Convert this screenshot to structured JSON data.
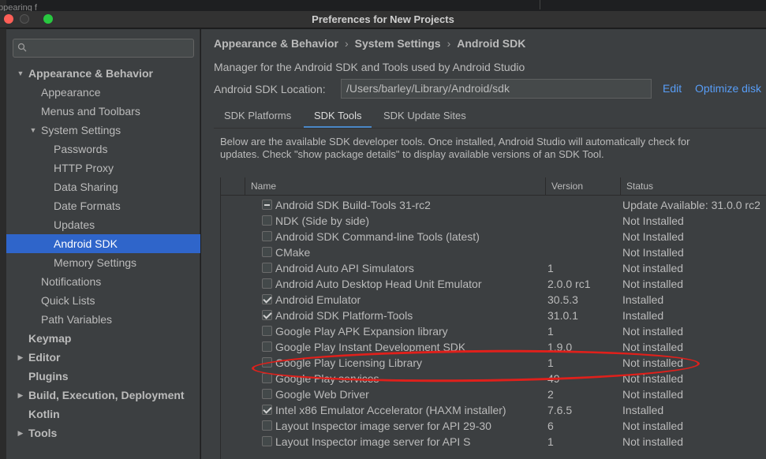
{
  "background_window": {
    "text": "ppearing f"
  },
  "window": {
    "title": "Preferences for New Projects"
  },
  "sidebar": {
    "search_placeholder": "Q~",
    "items": [
      {
        "label": "Appearance & Behavior",
        "level": 0,
        "expanded": true,
        "bold": true
      },
      {
        "label": "Appearance",
        "level": 1
      },
      {
        "label": "Menus and Toolbars",
        "level": 1
      },
      {
        "label": "System Settings",
        "level": 1,
        "expanded": true
      },
      {
        "label": "Passwords",
        "level": 2
      },
      {
        "label": "HTTP Proxy",
        "level": 2
      },
      {
        "label": "Data Sharing",
        "level": 2
      },
      {
        "label": "Date Formats",
        "level": 2
      },
      {
        "label": "Updates",
        "level": 2
      },
      {
        "label": "Android SDK",
        "level": 2,
        "selected": true
      },
      {
        "label": "Memory Settings",
        "level": 2
      },
      {
        "label": "Notifications",
        "level": 1
      },
      {
        "label": "Quick Lists",
        "level": 1
      },
      {
        "label": "Path Variables",
        "level": 1
      },
      {
        "label": "Keymap",
        "level": 0,
        "bold": true
      },
      {
        "label": "Editor",
        "level": 0,
        "collapsed": true,
        "bold": true
      },
      {
        "label": "Plugins",
        "level": 0,
        "bold": true
      },
      {
        "label": "Build, Execution, Deployment",
        "level": 0,
        "collapsed": true,
        "bold": true
      },
      {
        "label": "Kotlin",
        "level": 0,
        "bold": true
      },
      {
        "label": "Tools",
        "level": 0,
        "collapsed": true,
        "bold": true
      }
    ]
  },
  "main": {
    "breadcrumb": [
      "Appearance & Behavior",
      "System Settings",
      "Android SDK"
    ],
    "breadcrumb_sep": "›",
    "description": "Manager for the Android SDK and Tools used by Android Studio",
    "sdk_location_label": "Android SDK Location:",
    "sdk_location_value": "/Users/barley/Library/Android/sdk",
    "edit_link": "Edit",
    "optimize_link": "Optimize disk",
    "tabs": [
      {
        "label": "SDK Platforms",
        "active": false
      },
      {
        "label": "SDK Tools",
        "active": true
      },
      {
        "label": "SDK Update Sites",
        "active": false
      }
    ],
    "tools_description": "Below are the available SDK developer tools. Once installed, Android Studio will automatically check for updates. Check \"show package details\" to display available versions of an SDK Tool.",
    "table": {
      "columns": [
        "Name",
        "Version",
        "Status"
      ],
      "rows": [
        {
          "name": "Android SDK Build-Tools 31-rc2",
          "version": "",
          "status": "Update Available: 31.0.0 rc2",
          "check": "partial"
        },
        {
          "name": "NDK (Side by side)",
          "version": "",
          "status": "Not Installed",
          "check": "none"
        },
        {
          "name": "Android SDK Command-line Tools (latest)",
          "version": "",
          "status": "Not Installed",
          "check": "none"
        },
        {
          "name": "CMake",
          "version": "",
          "status": "Not Installed",
          "check": "none"
        },
        {
          "name": "Android Auto API Simulators",
          "version": "1",
          "status": "Not installed",
          "check": "none"
        },
        {
          "name": "Android Auto Desktop Head Unit Emulator",
          "version": "2.0.0 rc1",
          "status": "Not installed",
          "check": "none"
        },
        {
          "name": "Android Emulator",
          "version": "30.5.3",
          "status": "Installed",
          "check": "checked"
        },
        {
          "name": "Android SDK Platform-Tools",
          "version": "31.0.1",
          "status": "Installed",
          "check": "checked"
        },
        {
          "name": "Google Play APK Expansion library",
          "version": "1",
          "status": "Not installed",
          "check": "none"
        },
        {
          "name": "Google Play Instant Development SDK",
          "version": "1.9.0",
          "status": "Not installed",
          "check": "none"
        },
        {
          "name": "Google Play Licensing Library",
          "version": "1",
          "status": "Not installed",
          "check": "none"
        },
        {
          "name": "Google Play services",
          "version": "49",
          "status": "Not installed",
          "check": "none"
        },
        {
          "name": "Google Web Driver",
          "version": "2",
          "status": "Not installed",
          "check": "none"
        },
        {
          "name": "Intel x86 Emulator Accelerator (HAXM installer)",
          "version": "7.6.5",
          "status": "Installed",
          "check": "checked"
        },
        {
          "name": "Layout Inspector image server for API 29-30",
          "version": "6",
          "status": "Not installed",
          "check": "none"
        },
        {
          "name": "Layout Inspector image server for API S",
          "version": "1",
          "status": "Not installed",
          "check": "none"
        }
      ]
    },
    "highlighted_row": "Google Play Licensing Library"
  },
  "colors": {
    "selection": "#2f65ca",
    "link": "#589df6",
    "highlight_annotation": "#e0201b"
  }
}
